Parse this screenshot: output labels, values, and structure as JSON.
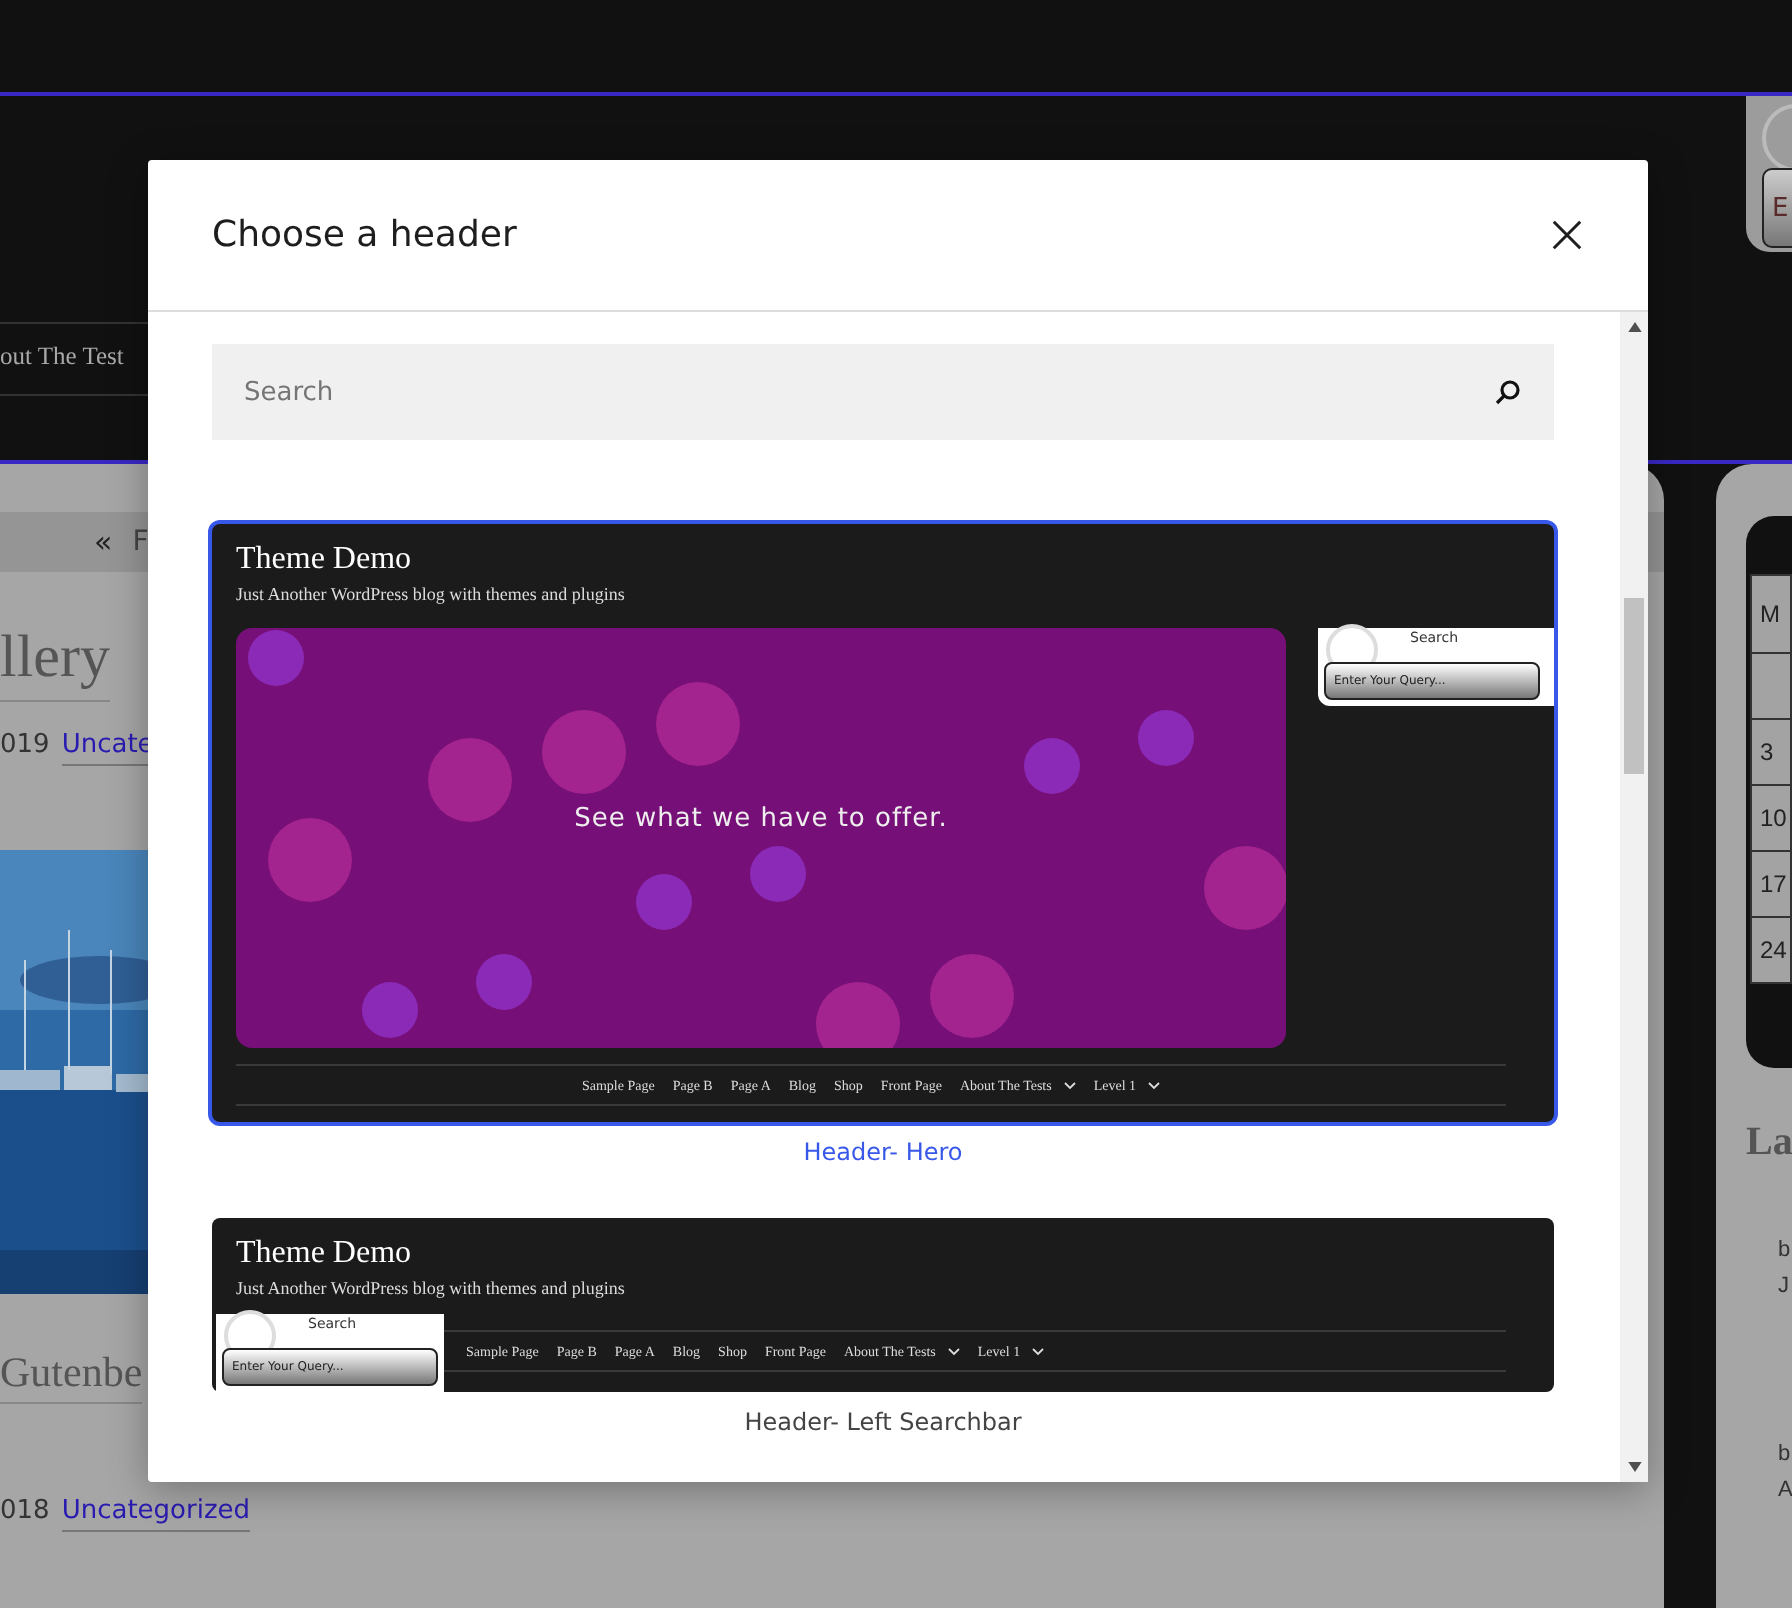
{
  "background": {
    "header_nav_fragment": "out The Test",
    "top_right_button": "E",
    "post_nav": {
      "arrow": "«",
      "label": "F"
    },
    "posts": [
      {
        "kind": "title",
        "text": "llery"
      },
      {
        "kind": "meta",
        "date": "019",
        "category": "Uncate"
      },
      {
        "kind": "picture"
      },
      {
        "kind": "title",
        "text": "Gutenbe"
      },
      {
        "kind": "meta",
        "date": "018",
        "category": "Uncategorized"
      }
    ],
    "calendar": [
      {
        "kind": "head",
        "text": "M"
      },
      {
        "kind": "blank"
      },
      {
        "kind": "day",
        "text": "3"
      },
      {
        "kind": "day",
        "text": "10"
      },
      {
        "kind": "day",
        "text": "17"
      },
      {
        "kind": "day",
        "text": "24"
      }
    ],
    "latest": {
      "title": "La",
      "items": [
        {
          "kind": "meta",
          "text": "b"
        },
        {
          "kind": "meta",
          "text": "J"
        },
        {
          "kind": "meta",
          "text": "b"
        },
        {
          "kind": "meta",
          "text": "A"
        }
      ]
    }
  },
  "modal": {
    "title": "Choose a header",
    "search": {
      "placeholder": "Search"
    },
    "options": [
      {
        "caption": "Header- Hero",
        "selected": true,
        "kind": "hero",
        "preview": {
          "site_title": "Theme Demo",
          "tagline": "Just Another WordPress blog with themes and plugins",
          "hero_text": "See what we have to offer.",
          "search_label": "Search",
          "search_placeholder": "Enter Your Query...",
          "nav": [
            {
              "label": "Sample Page",
              "submenu": false
            },
            {
              "label": "Page B",
              "submenu": false
            },
            {
              "label": "Page A",
              "submenu": false
            },
            {
              "label": "Blog",
              "submenu": false
            },
            {
              "label": "Shop",
              "submenu": false
            },
            {
              "label": "Front Page",
              "submenu": false
            },
            {
              "label": "About The Tests",
              "submenu": true
            },
            {
              "label": "Level 1",
              "submenu": true
            }
          ]
        }
      },
      {
        "caption": "Header- Left Searchbar",
        "selected": false,
        "kind": "left-searchbar",
        "preview": {
          "site_title": "Theme Demo",
          "tagline": "Just Another WordPress blog with themes and plugins",
          "search_label": "Search",
          "search_placeholder": "Enter Your Query...",
          "nav": [
            {
              "label": "Sample Page",
              "submenu": false
            },
            {
              "label": "Page B",
              "submenu": false
            },
            {
              "label": "Page A",
              "submenu": false
            },
            {
              "label": "Blog",
              "submenu": false
            },
            {
              "label": "Shop",
              "submenu": false
            },
            {
              "label": "Front Page",
              "submenu": false
            },
            {
              "label": "About The Tests",
              "submenu": true
            },
            {
              "label": "Level 1",
              "submenu": true
            }
          ]
        }
      }
    ]
  }
}
